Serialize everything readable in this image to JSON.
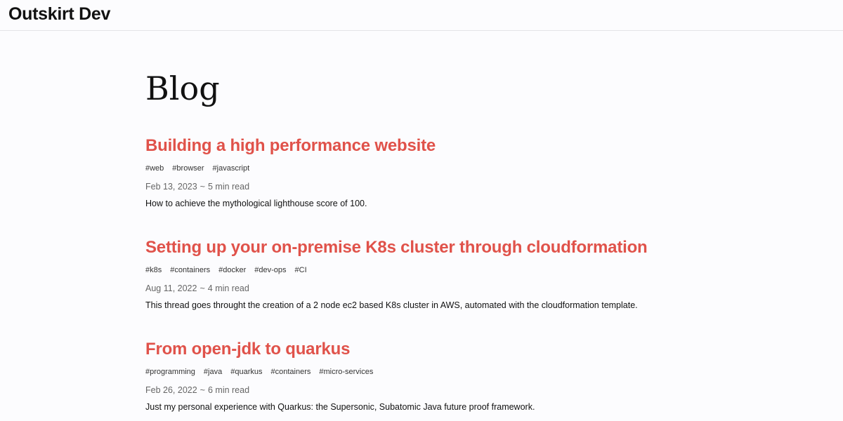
{
  "header": {
    "logo": "Outskirt Dev"
  },
  "main": {
    "title": "Blog",
    "meta_separator": "~",
    "posts": [
      {
        "title": "Building a high performance website",
        "tags": [
          "#web",
          "#browser",
          "#javascript"
        ],
        "date": "Feb 13, 2023",
        "read_time": "5 min read",
        "summary": "How to achieve the mythological lighthouse score of 100."
      },
      {
        "title": "Setting up your on-premise K8s cluster through cloudformation",
        "tags": [
          "#k8s",
          "#containers",
          "#docker",
          "#dev-ops",
          "#CI"
        ],
        "date": "Aug 11, 2022",
        "read_time": "4 min read",
        "summary": "This thread goes throught the creation of a 2 node ec2 based K8s cluster in AWS, automated with the cloudformation template."
      },
      {
        "title": "From open-jdk to quarkus",
        "tags": [
          "#programming",
          "#java",
          "#quarkus",
          "#containers",
          "#micro-services"
        ],
        "date": "Feb 26, 2022",
        "read_time": "6 min read",
        "summary": "Just my personal experience with Quarkus: the Supersonic, Subatomic Java future proof framework."
      }
    ]
  }
}
